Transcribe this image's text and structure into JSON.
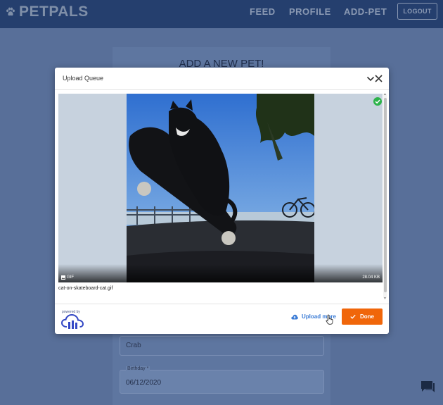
{
  "navbar": {
    "brand": "PETPALS",
    "links": [
      "FEED",
      "PROFILE",
      "ADD-PET"
    ],
    "logout_label": "LOGOUT"
  },
  "form": {
    "title": "ADD A NEW PET!",
    "species_value": "Crab",
    "birthday_label": "Birthday *",
    "birthday_value": "06/12/2020"
  },
  "modal": {
    "title": "Upload Queue",
    "file": {
      "name": "cat-on-skateboard-cat.gif",
      "type": "GIF",
      "size": "28.04 KB",
      "status": "uploaded"
    },
    "powered_by": "powered by",
    "upload_more_label": "Upload more",
    "done_label": "Done"
  },
  "icons": {
    "brand": "paw-icon",
    "modal": [
      "chevron-down-icon",
      "close-icon",
      "check-circle-icon",
      "image-icon",
      "cloud-upload-icon",
      "check-icon"
    ],
    "chat": "chat-icon",
    "cursor": "hand-cursor-icon"
  },
  "colors": {
    "navbar": "#253f6e",
    "accent_done": "#f0660a",
    "link": "#3a7bd5",
    "success": "#2db34a"
  }
}
